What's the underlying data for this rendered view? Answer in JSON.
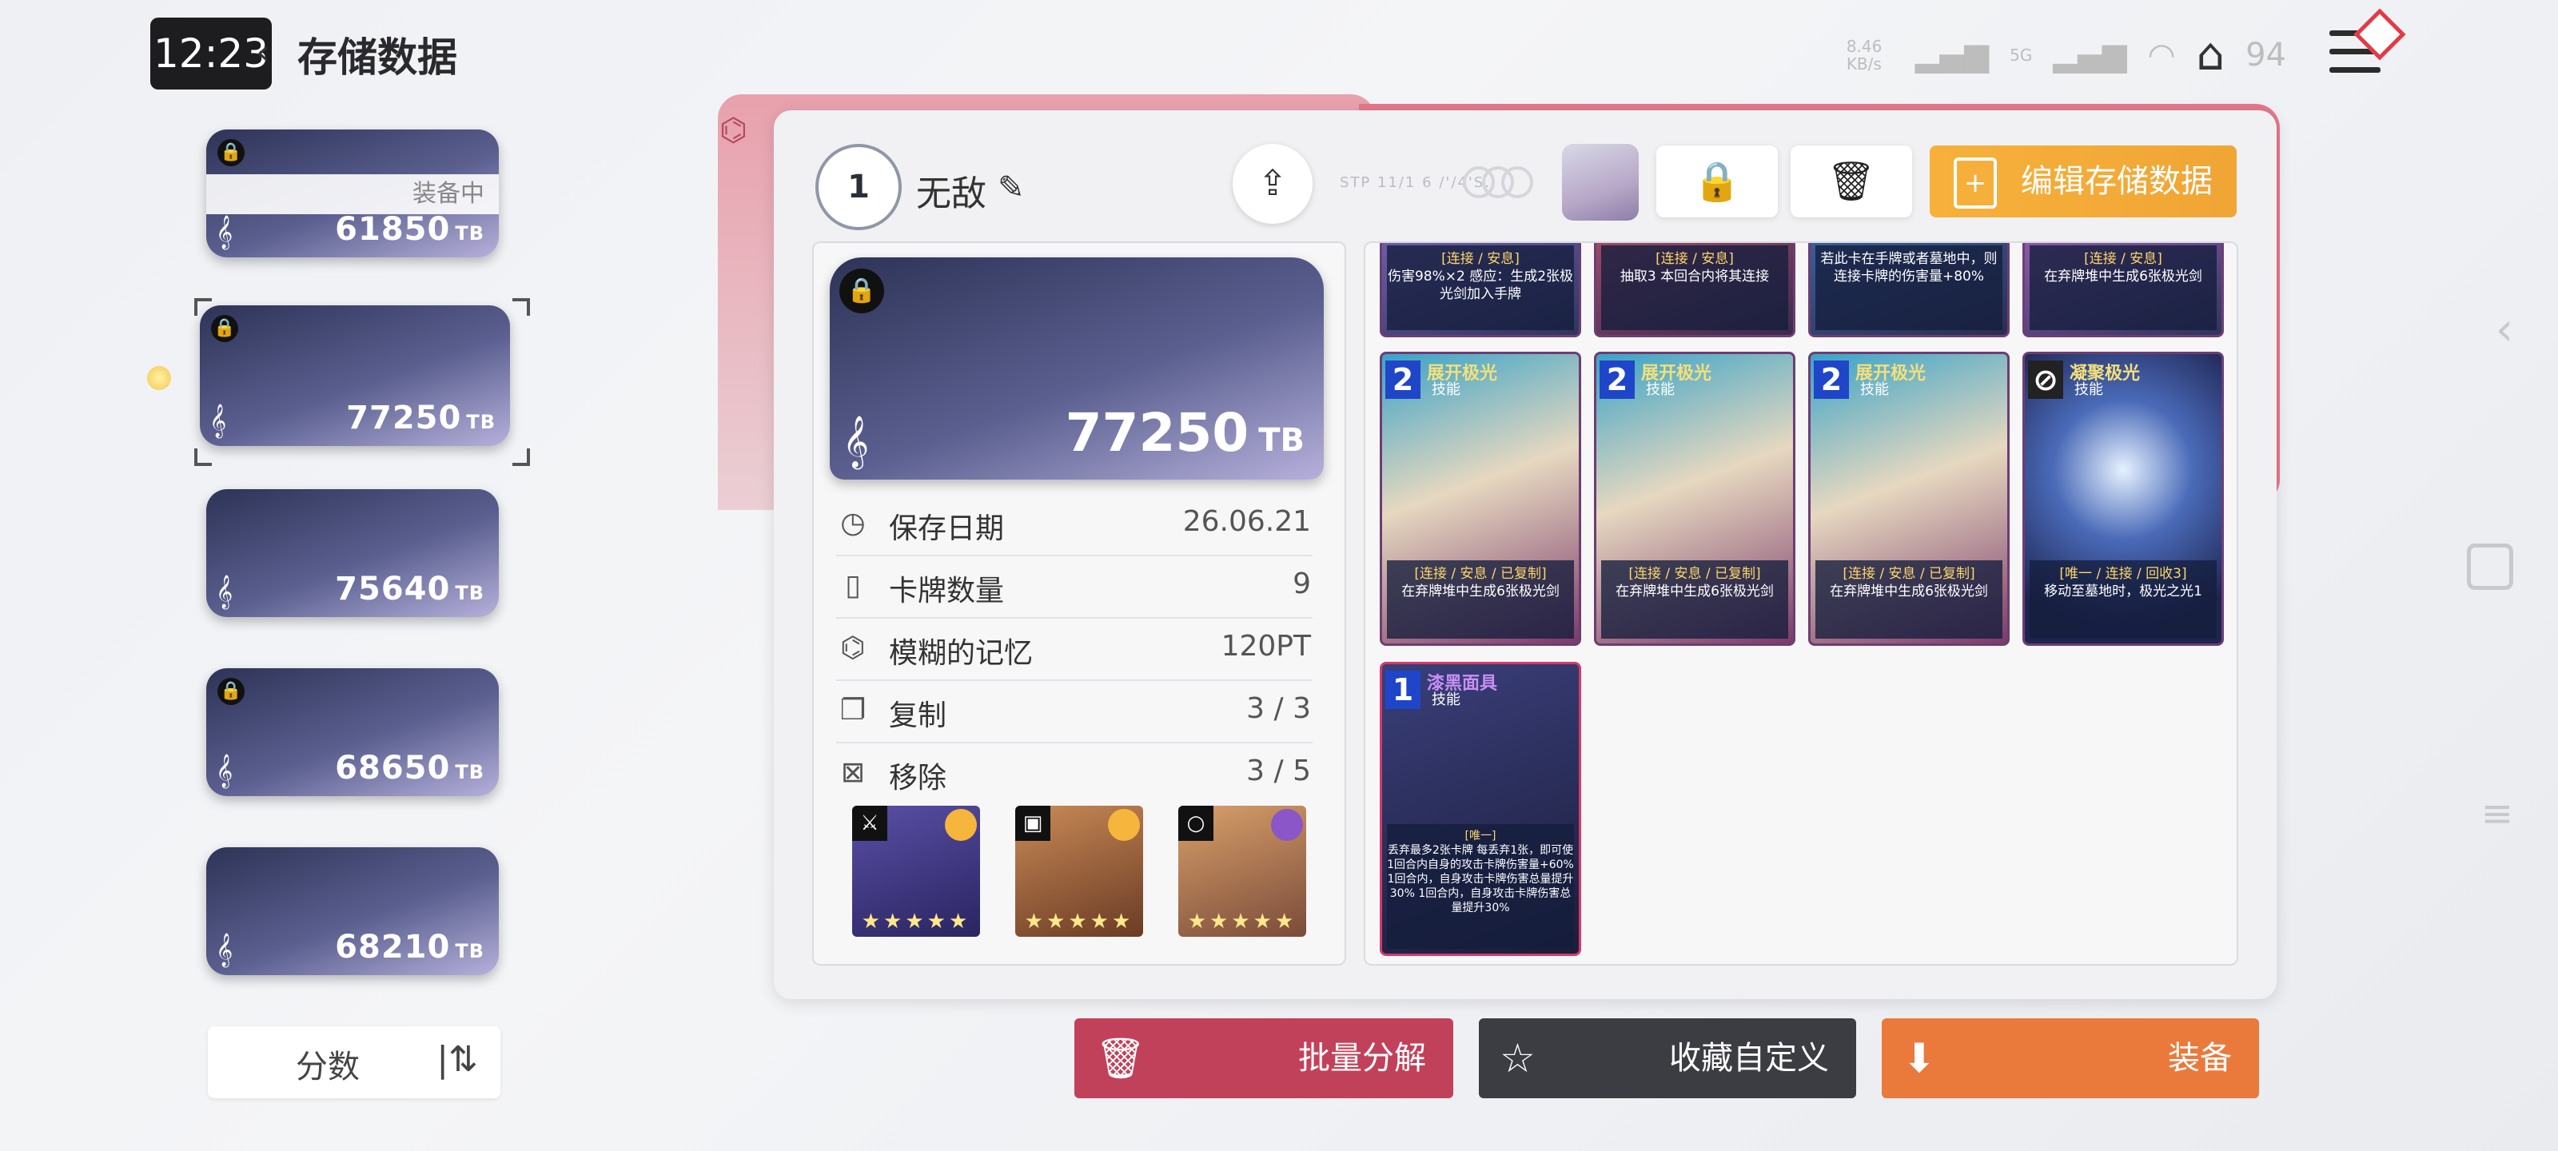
{
  "status": {
    "time": "12:23",
    "net_speed": "8.46 KB/s",
    "net_type_1": "5G",
    "net_type_2": "5G",
    "battery": "94"
  },
  "header": {
    "title": "存储数据"
  },
  "save_list": {
    "items": [
      {
        "score": "61850",
        "unit": "TB",
        "locked": true,
        "tag": "装备中"
      },
      {
        "score": "77250",
        "unit": "TB",
        "locked": true,
        "selected": true
      },
      {
        "score": "75640",
        "unit": "TB",
        "locked": false
      },
      {
        "score": "68650",
        "unit": "TB",
        "locked": true
      },
      {
        "score": "68210",
        "unit": "TB",
        "locked": false
      }
    ],
    "sort_label": "分数"
  },
  "detail": {
    "rank": "1",
    "name": "无敌",
    "faint_label": "STP 11/1 6 /'/4'S.",
    "edit_button": "编辑存储数据",
    "score": "77250",
    "unit": "TB",
    "rows": [
      {
        "label": "保存日期",
        "value": "26.06.21",
        "icon": "clock-icon"
      },
      {
        "label": "卡牌数量",
        "value": "9",
        "icon": "cards-icon"
      },
      {
        "label": "模糊的记忆",
        "value": "120PT",
        "icon": "brain-icon"
      },
      {
        "label": "复制",
        "value": "3 / 3",
        "icon": "copy-icon"
      },
      {
        "label": "移除",
        "value": "3 / 5",
        "icon": "remove-icon"
      }
    ]
  },
  "cards_top": [
    {
      "tags": "[连接 / 安息]",
      "text": "伤害98%×2 感应：生成2张极光剑加入手牌"
    },
    {
      "tags": "[连接 / 安息]",
      "text": "抽取3 本回合内将其连接"
    },
    {
      "tags": "",
      "text": "若此卡在手牌或者墓地中，则连接卡牌的伤害量+80%"
    },
    {
      "tags": "[连接 / 安息]",
      "text": "在弃牌堆中生成6张极光剑"
    }
  ],
  "cards": [
    {
      "cost": "2",
      "name": "展开极光",
      "type": "技能",
      "tags": "[连接 / 安息 / 已复制]",
      "text": "在弃牌堆中生成6张极光剑"
    },
    {
      "cost": "2",
      "name": "展开极光",
      "type": "技能",
      "tags": "[连接 / 安息 / 已复制]",
      "text": "在弃牌堆中生成6张极光剑"
    },
    {
      "cost": "2",
      "name": "展开极光",
      "type": "技能",
      "tags": "[连接 / 安息 / 已复制]",
      "text": "在弃牌堆中生成6张极光剑"
    },
    {
      "cost": "⊘",
      "name": "凝聚极光",
      "type": "技能",
      "tags": "[唯一 / 连接 / 回收3]",
      "text": "移动至墓地时，极光之光1"
    }
  ],
  "card_last": {
    "cost": "1",
    "name": "漆黑面具",
    "type": "技能",
    "tags": "[唯一]",
    "text": "丢弃最多2张卡牌 每丢弃1张，即可使1回合内自身的攻击卡牌伤害量+60% 1回合内，自身攻击卡牌伤害总量提升30% 1回合内，自身攻击卡牌伤害总量提升30%"
  },
  "actions": {
    "dismantle": "批量分解",
    "favorite": "收藏自定义",
    "equip": "装备"
  },
  "colors": {
    "accent_orange": "#f0a535",
    "dismantle_red": "#c2415a",
    "dark_btn": "#3c3d42"
  }
}
